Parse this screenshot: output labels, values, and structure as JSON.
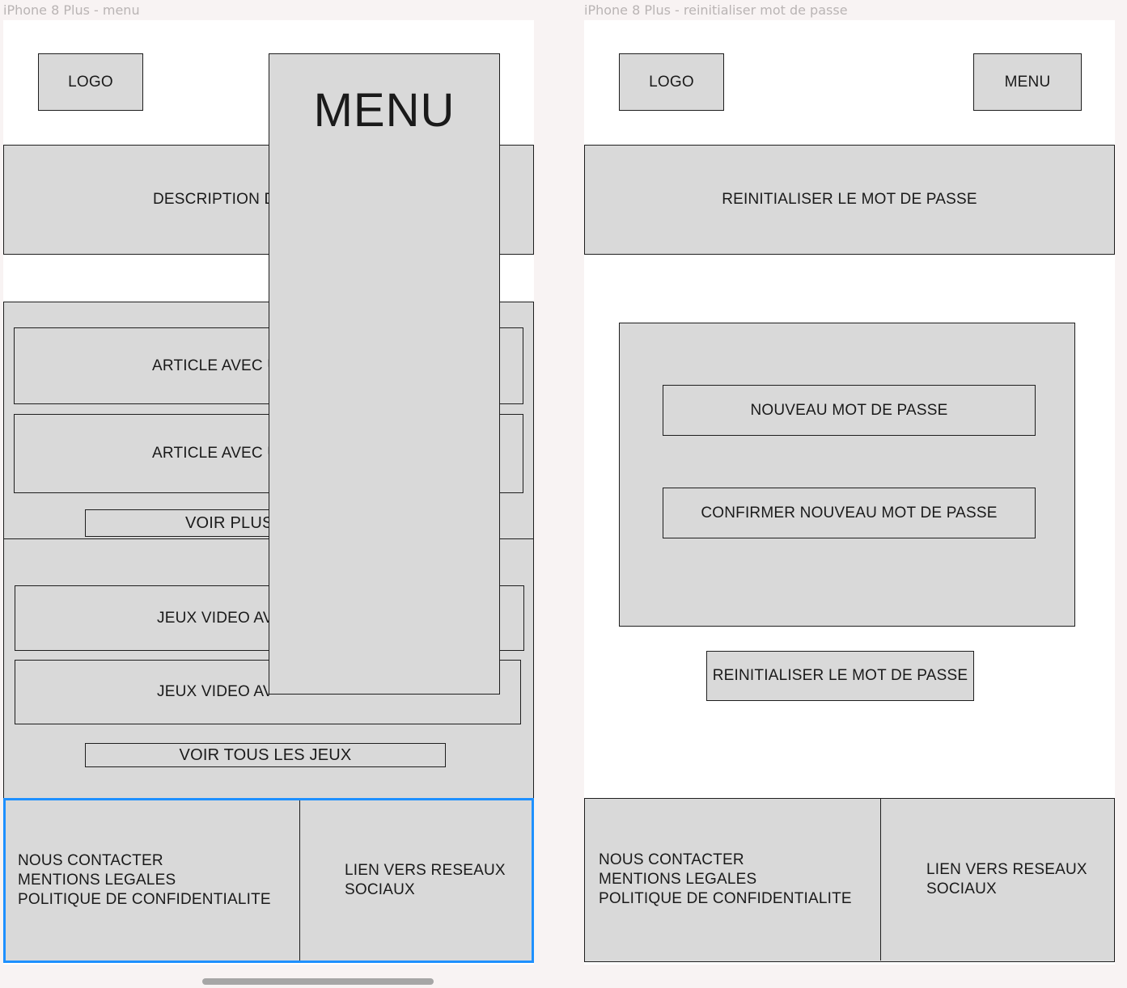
{
  "frame1": {
    "title": "iPhone 8 Plus - menu",
    "logo": "LOGO",
    "description": "DESCRIPTION D",
    "articles": [
      "ARTICLE AVEC U",
      "ARTICLE AVEC U"
    ],
    "voir_plus": "VOIR PLUS",
    "games": [
      "JEUX VIDEO AV",
      "JEUX VIDEO AV"
    ],
    "voir_tous_les_jeux": "VOIR TOUS LES JEUX",
    "footer": {
      "links": [
        "NOUS CONTACTER",
        "MENTIONS LEGALES",
        "POLITIQUE DE CONFIDENTIALITE"
      ],
      "social": [
        "LIEN VERS RESEAUX",
        "SOCIAUX"
      ]
    },
    "menu_overlay_title": "MENU"
  },
  "frame2": {
    "title": "iPhone 8 Plus - reinitialiser mot de passe",
    "logo": "LOGO",
    "menu_button": "MENU",
    "heading": "REINITIALISER LE MOT DE PASSE",
    "new_password": "NOUVEAU MOT DE PASSE",
    "confirm_password": "CONFIRMER NOUVEAU MOT DE PASSE",
    "submit": "REINITIALISER LE MOT DE PASSE",
    "footer": {
      "links": [
        "NOUS CONTACTER",
        "MENTIONS LEGALES",
        "POLITIQUE DE CONFIDENTIALITE"
      ],
      "social": [
        "LIEN VERS RESEAUX",
        "SOCIAUX"
      ]
    }
  },
  "colors": {
    "canvas": "#f8f3f3",
    "frame": "#ffffff",
    "placeholder": "#d9d9d9",
    "stroke": "#1e1e1e",
    "selection": "#1e90ff",
    "frame_title": "#b9b4b4",
    "scrollbar": "#a6a6a6"
  }
}
